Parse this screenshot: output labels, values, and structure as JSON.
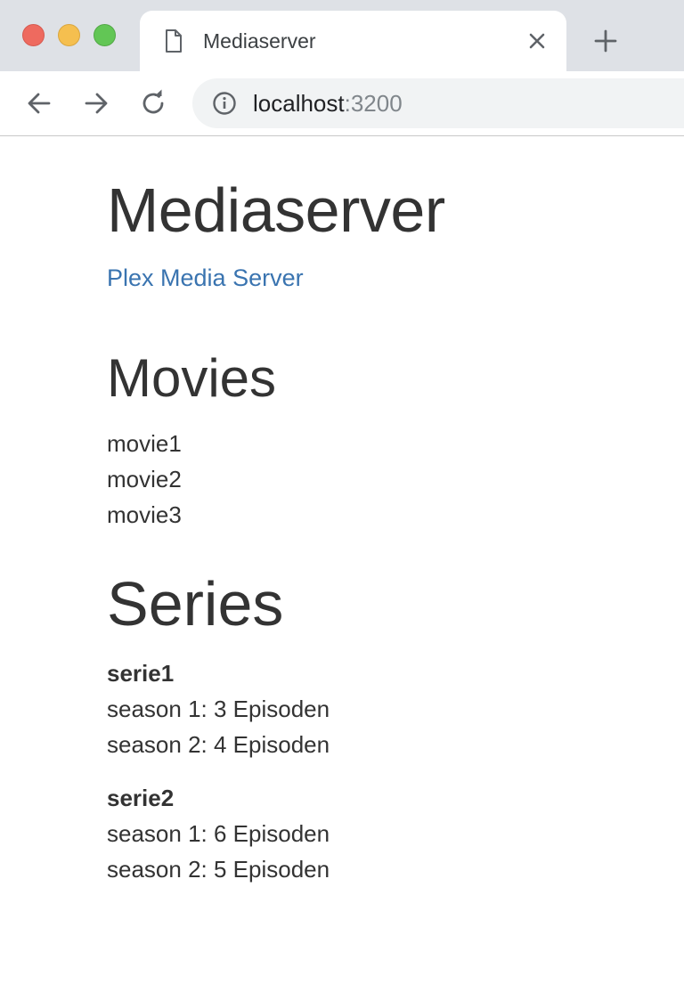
{
  "browser": {
    "tab_title": "Mediaserver",
    "url_host": "localhost",
    "url_port": ":3200",
    "icons": [
      "document-icon",
      "close-icon",
      "plus-icon",
      "back-arrow-icon",
      "forward-arrow-icon",
      "reload-icon",
      "info-icon"
    ]
  },
  "page": {
    "title": "Mediaserver",
    "link_text": "Plex Media Server"
  },
  "movies": {
    "heading": "Movies",
    "items": [
      "movie1",
      "movie2",
      "movie3"
    ]
  },
  "series": {
    "heading": "Series",
    "items": [
      {
        "name": "serie1",
        "seasons": [
          "season 1: 3 Episoden",
          "season 2: 4 Episoden"
        ]
      },
      {
        "name": "serie2",
        "seasons": [
          "season 1: 6 Episoden",
          "season 2: 5 Episoden"
        ]
      }
    ]
  },
  "colors": {
    "link": "#3a74b0",
    "text": "#333333",
    "chrome_bg": "#dee1e6"
  }
}
